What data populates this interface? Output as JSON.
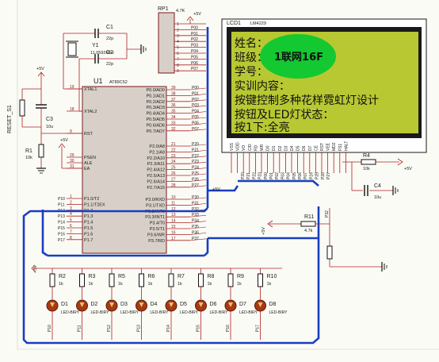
{
  "mcu": {
    "ref": "U1",
    "part": "AT89C52",
    "left_pins": [
      {
        "num": "19",
        "name": "XTAL1"
      },
      {
        "num": "18",
        "name": "XTAL2"
      },
      {
        "num": "9",
        "name": "RST"
      },
      {
        "num": "29",
        "name": "PSEN"
      },
      {
        "num": "30",
        "name": "ALE"
      },
      {
        "num": "31",
        "name": "EA"
      },
      {
        "num": "1",
        "name": "P1.0/T2",
        "net": "P10"
      },
      {
        "num": "2",
        "name": "P1.1/T2EX",
        "net": "P11"
      },
      {
        "num": "3",
        "name": "P1.2",
        "net": "P12"
      },
      {
        "num": "4",
        "name": "P1.3",
        "net": "P13"
      },
      {
        "num": "5",
        "name": "P1.4",
        "net": "P14"
      },
      {
        "num": "6",
        "name": "P1.5",
        "net": "P15"
      },
      {
        "num": "7",
        "name": "P1.6",
        "net": "P16"
      },
      {
        "num": "8",
        "name": "P1.7",
        "net": "P17"
      }
    ],
    "right_pins": [
      {
        "num": "39",
        "name": "P0.0/AD0",
        "net": "P00"
      },
      {
        "num": "38",
        "name": "P0.1/AD1",
        "net": "P01"
      },
      {
        "num": "37",
        "name": "P0.2/AD2",
        "net": "P02"
      },
      {
        "num": "36",
        "name": "P0.3/AD3",
        "net": "P03"
      },
      {
        "num": "35",
        "name": "P0.4/AD4",
        "net": "P04"
      },
      {
        "num": "34",
        "name": "P0.5/AD5",
        "net": "P05"
      },
      {
        "num": "33",
        "name": "P0.6/AD6",
        "net": "P06"
      },
      {
        "num": "32",
        "name": "P0.7/AD7",
        "net": "P07"
      },
      {
        "num": "21",
        "name": "P2.0/A8",
        "net": "P20"
      },
      {
        "num": "22",
        "name": "P2.1/A9",
        "net": "P21"
      },
      {
        "num": "23",
        "name": "P2.2/A10",
        "net": "P22"
      },
      {
        "num": "24",
        "name": "P2.3/A11",
        "net": "P23"
      },
      {
        "num": "25",
        "name": "P2.4/A12",
        "net": "P24"
      },
      {
        "num": "26",
        "name": "P2.5/A13",
        "net": "P25"
      },
      {
        "num": "27",
        "name": "P2.6/A14",
        "net": "P26"
      },
      {
        "num": "28",
        "name": "P2.7/A15",
        "net": "P27"
      },
      {
        "num": "10",
        "name": "P3.0/RXD",
        "net": "P30"
      },
      {
        "num": "11",
        "name": "P3.1/TXD",
        "net": "P31"
      },
      {
        "num": "12",
        "name": "P3.2/INT0",
        "net": "P32"
      },
      {
        "num": "13",
        "name": "P3.3/INT1",
        "net": "P33"
      },
      {
        "num": "14",
        "name": "P3.4/T0",
        "net": "P34"
      },
      {
        "num": "15",
        "name": "P3.5/T1",
        "net": "P35"
      },
      {
        "num": "16",
        "name": "P3.6/WR",
        "net": "P36"
      },
      {
        "num": "17",
        "name": "P3.7/RD",
        "net": "P37"
      }
    ]
  },
  "rp1": {
    "ref": "RP1",
    "value": "4.7K",
    "pins": [
      "1",
      "2",
      "3",
      "4",
      "5",
      "6",
      "7",
      "8",
      "9"
    ],
    "nets": [
      "P00",
      "P01",
      "P02",
      "P03",
      "P04",
      "P05",
      "P06",
      "P07"
    ]
  },
  "crystal": {
    "c1_ref": "C1",
    "c1_val": "22p",
    "c2_ref": "C2",
    "c2_val": "22p",
    "y1_ref": "Y1",
    "y1_val": "11.0592Mhz"
  },
  "reset": {
    "label": "RESET_S1",
    "c3_ref": "C3",
    "c3_val": "10u",
    "r1_ref": "R1",
    "r1_val": "10k"
  },
  "power": {
    "vcc": "+5V"
  },
  "lcd": {
    "ref": "LCD1",
    "part": "LM4229",
    "lines": [
      "姓名：",
      "班级：",
      "学号：",
      "实训内容：",
      "按键控制多种花样霓虹灯设计",
      "按钮及LED灯状态：",
      "按1下:全亮"
    ],
    "overlay": "1联网16F",
    "pins": [
      "VSS",
      "VDD",
      "VO",
      "C/D",
      "RD",
      "WR",
      "D0",
      "D1",
      "D2",
      "D3",
      "D4",
      "D5",
      "D6",
      "D7",
      "CE",
      "RST",
      "VEE",
      "MD2",
      "FS1",
      "HALT"
    ],
    "nets": [
      "P20",
      "P21",
      "P22",
      "P23",
      "P00",
      "P01",
      "P02",
      "P03",
      "P04",
      "P05",
      "P06",
      "P07",
      "P24",
      "P25",
      "P26",
      "P27"
    ]
  },
  "r4": {
    "ref": "R4",
    "val": "10k"
  },
  "c4": {
    "ref": "C4",
    "val": "10u"
  },
  "r11": {
    "ref": "R11",
    "val": "4.7k",
    "net": "P32"
  },
  "leds": [
    {
      "r_ref": "R2",
      "r_val": "1k",
      "d_ref": "D1",
      "d_val": "LED-BIRY",
      "net": "P10"
    },
    {
      "r_ref": "R3",
      "r_val": "1k",
      "d_ref": "D2",
      "d_val": "LED-BIRY",
      "net": "P11"
    },
    {
      "r_ref": "R5",
      "r_val": "1k",
      "d_ref": "D3",
      "d_val": "LED-BIRY",
      "net": "P12"
    },
    {
      "r_ref": "R6",
      "r_val": "1k",
      "d_ref": "D4",
      "d_val": "LED-BIRY",
      "net": "P13"
    },
    {
      "r_ref": "R7",
      "r_val": "1k",
      "d_ref": "D5",
      "d_val": "LED-BIRY",
      "net": "P14"
    },
    {
      "r_ref": "R8",
      "r_val": "1k",
      "d_ref": "D6",
      "d_val": "LED-BIRY",
      "net": "P15"
    },
    {
      "r_ref": "R9",
      "r_val": "1k",
      "d_ref": "D7",
      "d_val": "LED-BIRY",
      "net": "P16"
    },
    {
      "r_ref": "R10",
      "r_val": "1k",
      "d_ref": "D8",
      "d_val": "LED-BIRY",
      "net": "P17"
    }
  ],
  "colors": {
    "wire": "#b02020",
    "bus": "#1a3ec0",
    "body": "#d8d0c8",
    "lcd_bg": "#b8c832",
    "lcd_frame": "#1a1a1a",
    "led": "#a83a10",
    "overlay": "#14c832"
  }
}
